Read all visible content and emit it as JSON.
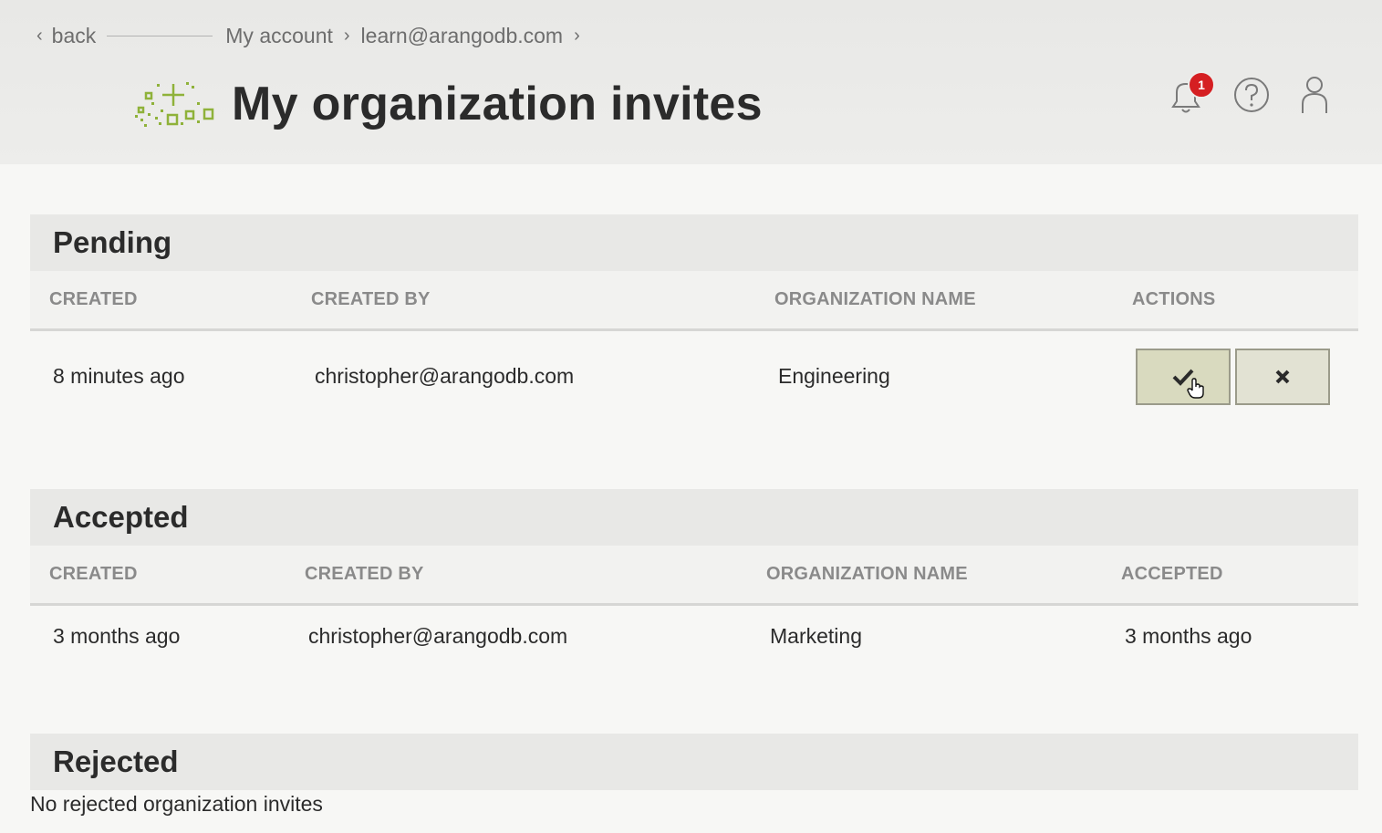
{
  "breadcrumb": {
    "back_label": "back",
    "items": [
      "My account",
      "learn@arangodb.com"
    ]
  },
  "page_title": "My organization invites",
  "notifications": {
    "count": "1"
  },
  "colors": {
    "badge": "#d51f22",
    "logo": "#8fb23a",
    "accept_button": "#d9dabf"
  },
  "pending": {
    "title": "Pending",
    "columns": [
      "CREATED",
      "CREATED BY",
      "ORGANIZATION NAME",
      "ACTIONS"
    ],
    "rows": [
      {
        "created": "8 minutes ago",
        "created_by": "christopher@arangodb.com",
        "organization_name": "Engineering"
      }
    ],
    "actions": {
      "accept_icon": "check-icon",
      "reject_icon": "close-icon"
    }
  },
  "accepted": {
    "title": "Accepted",
    "columns": [
      "CREATED",
      "CREATED BY",
      "ORGANIZATION NAME",
      "ACCEPTED"
    ],
    "rows": [
      {
        "created": "3 months ago",
        "created_by": "christopher@arangodb.com",
        "organization_name": "Marketing",
        "accepted": "3 months ago"
      }
    ]
  },
  "rejected": {
    "title": "Rejected",
    "empty_message": "No rejected organization invites"
  },
  "icons": [
    "chevron-left-icon",
    "chevron-right-icon",
    "bell-icon",
    "help-icon",
    "user-icon",
    "hand-cursor-icon"
  ]
}
